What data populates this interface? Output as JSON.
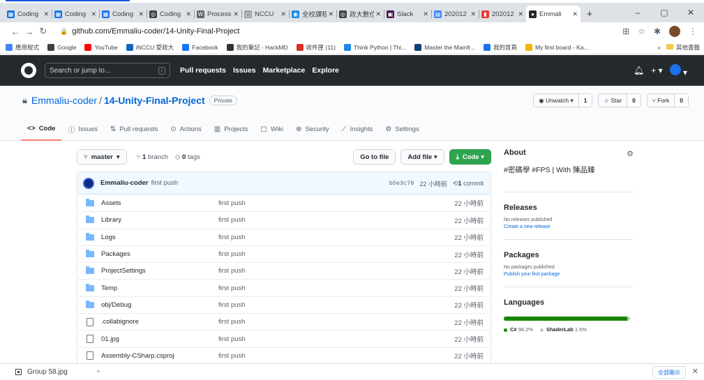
{
  "browser": {
    "tabs": [
      {
        "label": "Coding",
        "color": "#1a73e8",
        "glyph": "▦"
      },
      {
        "label": "Coding",
        "color": "#1a73e8",
        "glyph": "▦"
      },
      {
        "label": "Coding",
        "color": "#1a73e8",
        "glyph": "▦"
      },
      {
        "label": "Coding",
        "color": "#3c4043",
        "glyph": "◎"
      },
      {
        "label": "Process",
        "color": "#5f6368",
        "glyph": "W"
      },
      {
        "label": "NCCU",
        "color": "#9aa0a6",
        "glyph": "▢"
      },
      {
        "label": "全校課程",
        "color": "#1e88e5",
        "glyph": "◉"
      },
      {
        "label": "政大數位",
        "color": "#3c4043",
        "glyph": "◎"
      },
      {
        "label": "Slack",
        "color": "#4a154b",
        "glyph": "▣"
      },
      {
        "label": "202012",
        "color": "#4285f4",
        "glyph": "▤"
      },
      {
        "label": "202012",
        "color": "#e53935",
        "glyph": "▮"
      },
      {
        "label": "Emmali",
        "color": "#24292e",
        "glyph": "●"
      }
    ],
    "address": "github.com/Emmaliu-coder/14-Unity-Final-Project",
    "bookmarks": [
      {
        "label": "應用程式",
        "color": "#4285f4"
      },
      {
        "label": "Google",
        "color": "#3c4043"
      },
      {
        "label": "YouTube",
        "color": "#ff0000"
      },
      {
        "label": "iNCCU 愛政大",
        "color": "#1565c0"
      },
      {
        "label": "Facebook",
        "color": "#1877f2"
      },
      {
        "label": "我的筆記 - HackMD",
        "color": "#333333"
      },
      {
        "label": "收件匣 (11)",
        "color": "#d93025"
      },
      {
        "label": "Think Python | Thi...",
        "color": "#1e88e5"
      },
      {
        "label": "Master the Mainfr...",
        "color": "#0f3d7a"
      },
      {
        "label": "我的首頁",
        "color": "#1a73e8"
      },
      {
        "label": "My first board - Ka...",
        "color": "#f4b400"
      }
    ],
    "bookmarks_more": "»",
    "bookmarks_other": "其他書籤"
  },
  "github": {
    "search_placeholder": "Search or jump to...",
    "search_key": "/",
    "nav": [
      "Pull requests",
      "Issues",
      "Marketplace",
      "Explore"
    ]
  },
  "repo": {
    "owner": "Emmaliu-coder",
    "separator": "/",
    "name": "14-Unity-Final-Project",
    "visibility": "Private",
    "unwatch_label": "Unwatch ▾",
    "unwatch_count": "1",
    "star_label": "Star",
    "star_count": "0",
    "fork_label": "Fork",
    "fork_count": "0",
    "tabs": [
      {
        "icon": "<>",
        "label": "Code",
        "active": true
      },
      {
        "icon": "ⓘ",
        "label": "Issues"
      },
      {
        "icon": "⇅",
        "label": "Pull requests"
      },
      {
        "icon": "⊙",
        "label": "Actions"
      },
      {
        "icon": "▥",
        "label": "Projects"
      },
      {
        "icon": "▢",
        "label": "Wiki"
      },
      {
        "icon": "⊕",
        "label": "Security"
      },
      {
        "icon": "⟋",
        "label": "Insights"
      },
      {
        "icon": "⚙",
        "label": "Settings"
      }
    ]
  },
  "toolbar": {
    "branch": "master",
    "branch_count": "1",
    "branch_word": "branch",
    "tag_count": "0",
    "tag_word": "tags",
    "go_to_file": "Go to file",
    "add_file": "Add file ▾",
    "code": "Code ▾"
  },
  "commit": {
    "author": "Emmaliu-coder",
    "message": "first push",
    "sha": "b5e3c70",
    "time": "22 小時前",
    "count": "1",
    "count_word": "commit"
  },
  "files": [
    {
      "name": "Assets",
      "type": "dir",
      "message": "first push",
      "time": "22 小時前"
    },
    {
      "name": "Library",
      "type": "dir",
      "message": "first push",
      "time": "22 小時前"
    },
    {
      "name": "Logs",
      "type": "dir",
      "message": "first push",
      "time": "22 小時前"
    },
    {
      "name": "Packages",
      "type": "dir",
      "message": "first push",
      "time": "22 小時前"
    },
    {
      "name": "ProjectSettings",
      "type": "dir",
      "message": "first push",
      "time": "22 小時前"
    },
    {
      "name": "Temp",
      "type": "dir",
      "message": "first push",
      "time": "22 小時前"
    },
    {
      "name": "obj/Debug",
      "type": "dir",
      "message": "first push",
      "time": "22 小時前"
    },
    {
      "name": ".collabignore",
      "type": "file",
      "message": "first push",
      "time": "22 小時前"
    },
    {
      "name": "01.jpg",
      "type": "file",
      "message": "first push",
      "time": "22 小時前"
    },
    {
      "name": "Assembly-CSharp.csproj",
      "type": "file",
      "message": "first push",
      "time": "22 小時前"
    }
  ],
  "sidebar": {
    "about_title": "About",
    "about_desc": "#密碼學 #FPS | With 陳品臻",
    "releases_title": "Releases",
    "releases_note": "No releases published",
    "releases_link": "Create a new release",
    "packages_title": "Packages",
    "packages_note": "No packages published",
    "packages_link": "Publish your first package",
    "languages_title": "Languages",
    "languages": [
      {
        "name": "C#",
        "percent": "98.2%",
        "value": 98.2,
        "color": "#178600"
      },
      {
        "name": "ShaderLab",
        "percent": "1.5%",
        "value": 1.5,
        "color": "#c5c5c5"
      }
    ]
  },
  "download": {
    "file": "Group 58.jpg",
    "caret": "^",
    "show_all": "全部顯示",
    "close": "✕"
  }
}
